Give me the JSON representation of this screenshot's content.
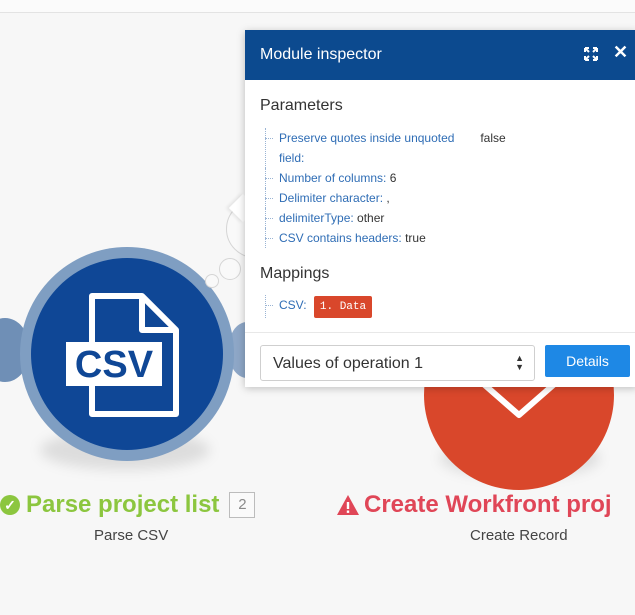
{
  "inspector": {
    "title": "Module inspector",
    "parameters_heading": "Parameters",
    "parameters": [
      {
        "key": "Preserve quotes inside unquoted field:",
        "value": "false"
      },
      {
        "key": "Number of columns:",
        "value": "6"
      },
      {
        "key": "Delimiter character:",
        "value": ","
      },
      {
        "key": "delimiterType:",
        "value": "other"
      },
      {
        "key": "CSV contains headers:",
        "value": "true"
      }
    ],
    "pqu_line1": "Preserve quotes inside unquoted",
    "pqu_line2": "field:",
    "mappings_heading": "Mappings",
    "mapping": {
      "key": "CSV:",
      "tag": "1. Data"
    },
    "select_value": "Values of operation 1",
    "details_label": "Details"
  },
  "modules": {
    "csv": {
      "icon_text": "CSV",
      "title": "Parse project list",
      "badge": "2",
      "subtitle": "Parse CSV",
      "status": "success"
    },
    "workfront": {
      "title": "Create Workfront proj",
      "subtitle": "Create Record",
      "status": "warning"
    }
  },
  "colors": {
    "header_blue": "#0c4a8f",
    "csv_blue": "#0f4796",
    "workfront_red": "#d9472b",
    "success_green": "#8cc63f",
    "error_red": "#e04657",
    "button_blue": "#1e88e5"
  },
  "icons": [
    "expand-icon",
    "close-icon",
    "csv-file-icon",
    "check-circle-icon",
    "warning-icon",
    "select-arrows-icon",
    "workfront-logo-icon"
  ]
}
